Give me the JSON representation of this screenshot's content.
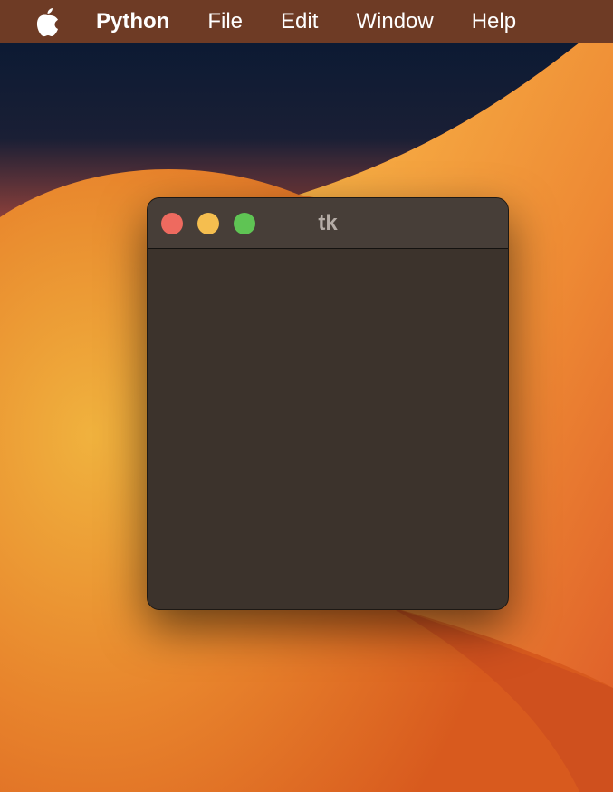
{
  "menubar": {
    "apple_icon": "apple-logo-icon",
    "items": [
      {
        "label": "Python",
        "bold": true
      },
      {
        "label": "File"
      },
      {
        "label": "Edit"
      },
      {
        "label": "Window"
      },
      {
        "label": "Help"
      }
    ]
  },
  "window": {
    "title": "tk",
    "controls": {
      "close": "#ee6a5f",
      "minimize": "#f5be4f",
      "zoom": "#5fc454"
    }
  }
}
